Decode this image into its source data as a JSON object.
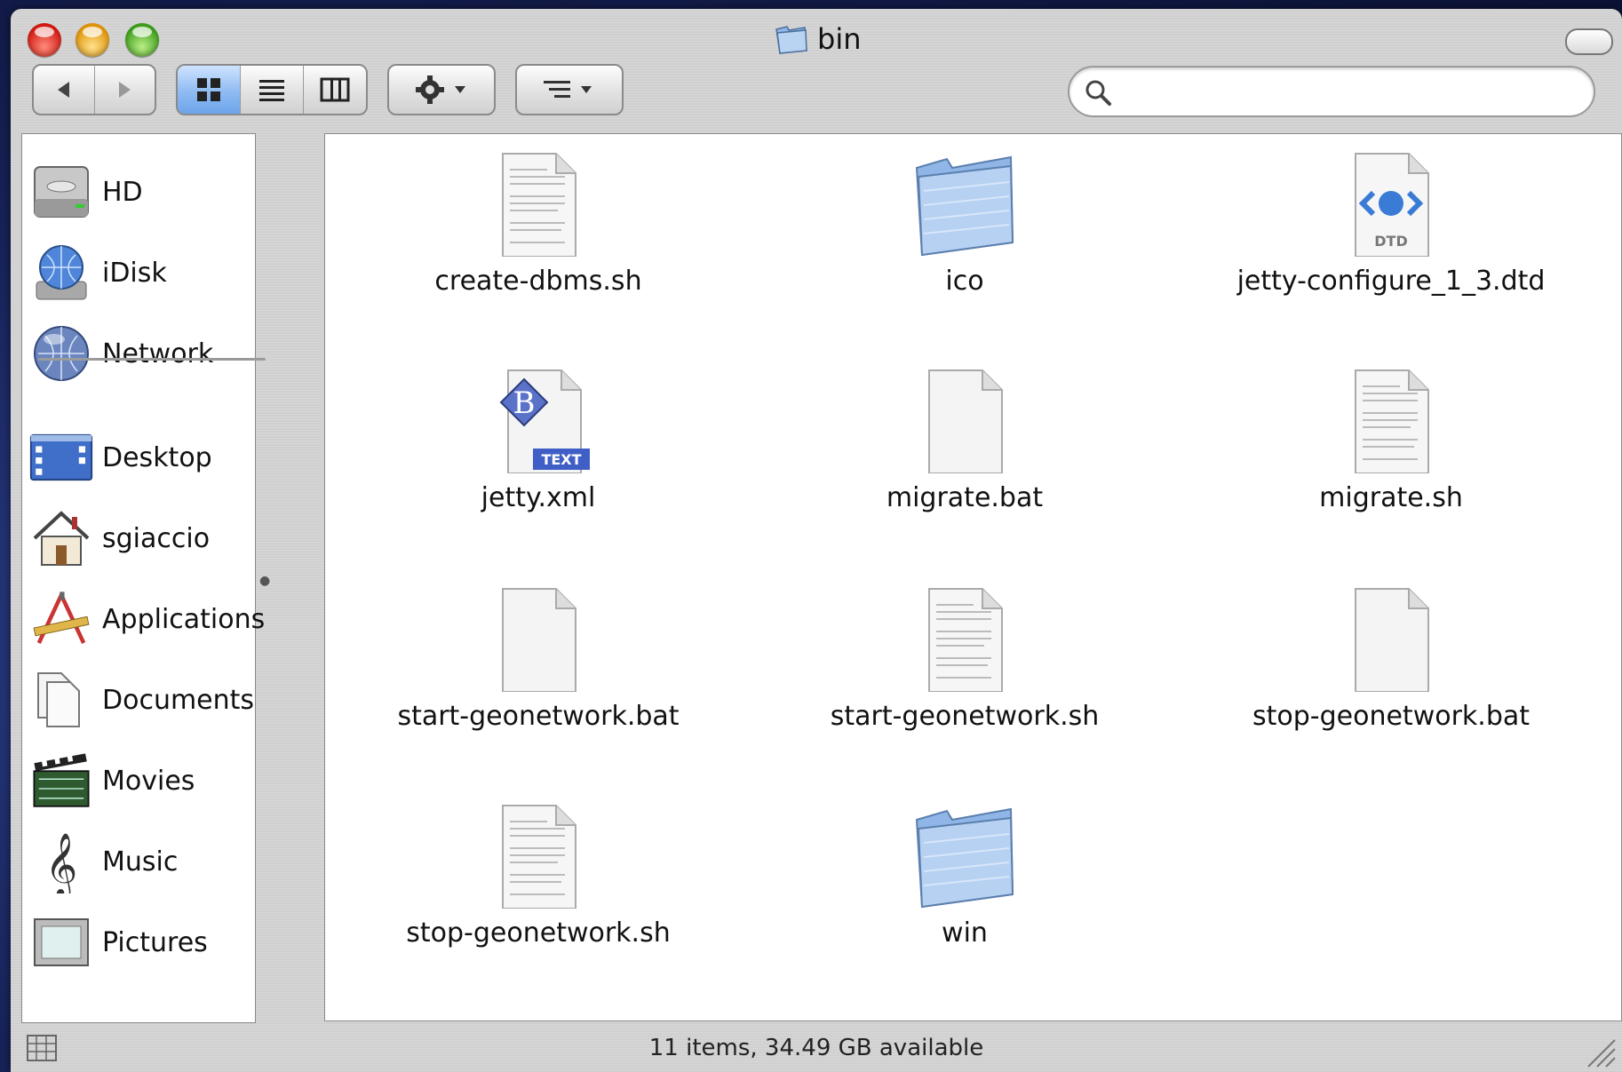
{
  "window": {
    "title": "bin",
    "title_icon": "folder-icon"
  },
  "toolbar": {
    "back_icon": "back-arrow-icon",
    "forward_icon": "forward-arrow-icon",
    "view_icon_mode": "icon-view-icon",
    "view_list_mode": "list-view-icon",
    "view_column_mode": "column-view-icon",
    "action_icon": "gear-icon",
    "arrange_icon": "arrange-icon"
  },
  "search": {
    "value": "",
    "placeholder": ""
  },
  "sidebar": {
    "devices": [
      {
        "label": "HD",
        "icon": "hard-drive-icon"
      },
      {
        "label": "iDisk",
        "icon": "idisk-icon"
      },
      {
        "label": "Network",
        "icon": "network-icon"
      }
    ],
    "places": [
      {
        "label": "Desktop",
        "icon": "desktop-icon"
      },
      {
        "label": "sgiaccio",
        "icon": "home-icon"
      },
      {
        "label": "Applications",
        "icon": "applications-icon"
      },
      {
        "label": "Documents",
        "icon": "documents-icon"
      },
      {
        "label": "Movies",
        "icon": "movies-icon"
      },
      {
        "label": "Music",
        "icon": "music-icon"
      },
      {
        "label": "Pictures",
        "icon": "pictures-icon"
      }
    ]
  },
  "files": [
    {
      "name": "create-dbms.sh",
      "kind": "text-document-icon"
    },
    {
      "name": "ico",
      "kind": "folder-icon"
    },
    {
      "name": "jetty-configure_1_3.dtd",
      "kind": "dtd-document-icon",
      "badge": "DTD"
    },
    {
      "name": "jetty.xml",
      "kind": "bbedit-text-icon",
      "badge": "TEXT"
    },
    {
      "name": "migrate.bat",
      "kind": "blank-document-icon"
    },
    {
      "name": "migrate.sh",
      "kind": "text-document-icon"
    },
    {
      "name": "start-geonetwork.bat",
      "kind": "blank-document-icon"
    },
    {
      "name": "start-geonetwork.sh",
      "kind": "text-document-icon"
    },
    {
      "name": "stop-geonetwork.bat",
      "kind": "blank-document-icon"
    },
    {
      "name": "stop-geonetwork.sh",
      "kind": "text-document-icon"
    },
    {
      "name": "win",
      "kind": "folder-icon"
    }
  ],
  "status": {
    "text": "11 items, 34.49 GB available"
  }
}
